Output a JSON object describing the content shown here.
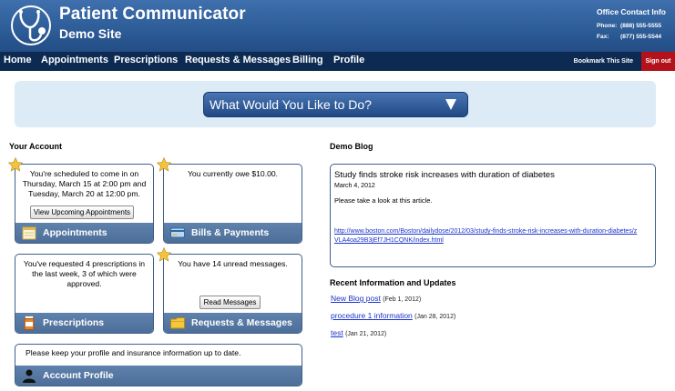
{
  "header": {
    "title": "Patient Communicator",
    "subtitle": "Demo Site",
    "contact": {
      "title": "Office Contact Info",
      "phone_label": "Phone:",
      "phone": "(888) 555-5555",
      "fax_label": "Fax:",
      "fax": "(877) 555-5544"
    }
  },
  "nav": {
    "items": [
      "Home",
      "Appointments",
      "Prescriptions",
      "Requests & Messages",
      "Billing",
      "Profile"
    ],
    "bookmark": "Bookmark This Site",
    "signout": "Sign out"
  },
  "banner": {
    "label": "What Would You Like to Do?"
  },
  "account": {
    "title": "Your Account",
    "appointments": {
      "text": "You're scheduled to come in on Thursday, March 15 at 2:00 pm and Tuesday, March 20 at 12:00 pm.",
      "button": "View Upcoming Appointments",
      "footer": "Appointments"
    },
    "bills": {
      "text": "You currently owe $10.00.",
      "footer": "Bills & Payments"
    },
    "prescriptions": {
      "text": "You've requested 4 prescriptions in the last week, 3 of which were approved.",
      "footer": "Prescriptions"
    },
    "messages": {
      "text": "You have 14 unread messages.",
      "button": "Read Messages",
      "footer": "Requests & Messages"
    },
    "profile": {
      "text": "Please keep your profile and insurance information up to date.",
      "footer": "Account Profile"
    }
  },
  "blog": {
    "title": "Demo Blog",
    "post_title": "Study finds stroke risk increases with duration of diabetes",
    "post_date": "March 4, 2012",
    "post_text": "Please take a look at this article.",
    "post_link": "http://www.boston.com/Boston/dailydose/2012/03/study-finds-stroke-risk-increases-with-duration-diabetes/zVLA4oa29B3jEf7JH1CQNK/index.html"
  },
  "updates": {
    "title": "Recent Information and Updates",
    "items": [
      {
        "label": "New Blog post",
        "date": "(Feb 1, 2012)"
      },
      {
        "label": "procedure 1 information",
        "date": "(Jan 28, 2012)"
      },
      {
        "label": "test",
        "date": "(Jan 21, 2012)"
      }
    ]
  },
  "colors": {
    "header": "#2e5d98",
    "nav": "#0d2a52",
    "signout": "#b3121b",
    "banner": "#dcebf6",
    "card_footer": "#5678a4",
    "link": "#1a33cc"
  }
}
